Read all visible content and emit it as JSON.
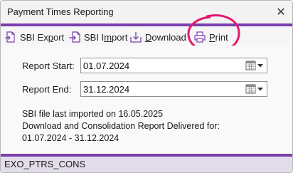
{
  "window": {
    "title": "Payment Times Reporting",
    "close_glyph": "✕"
  },
  "toolbar": {
    "export": {
      "prefix": "SBI Ex",
      "underlined": "p",
      "suffix": "ort",
      "icon": "export-icon"
    },
    "import": {
      "prefix": "SBI I",
      "underlined": "m",
      "suffix": "port",
      "icon": "import-icon"
    },
    "download": {
      "prefix": "",
      "underlined": "D",
      "suffix": "ownload",
      "icon": "download-icon"
    },
    "print": {
      "prefix": "",
      "underlined": "P",
      "suffix": "rint",
      "icon": "printer-icon"
    }
  },
  "form": {
    "report_start_label": "Report Start:",
    "report_start_value": "01.07.2024",
    "report_end_label": "Report End:",
    "report_end_value": "31.12.2024"
  },
  "info": {
    "line1": "SBI file last imported on 16.05.2025",
    "line2": "Download and Consolidation Report Delivered for:",
    "line3": "01.07.2024 - 31.12.2024"
  },
  "status": {
    "text": "EXO_PTRS_CONS"
  },
  "colors": {
    "accent": "#7a3fae",
    "status_bg": "#e3dcea",
    "highlight_circle": "#e4196d"
  }
}
